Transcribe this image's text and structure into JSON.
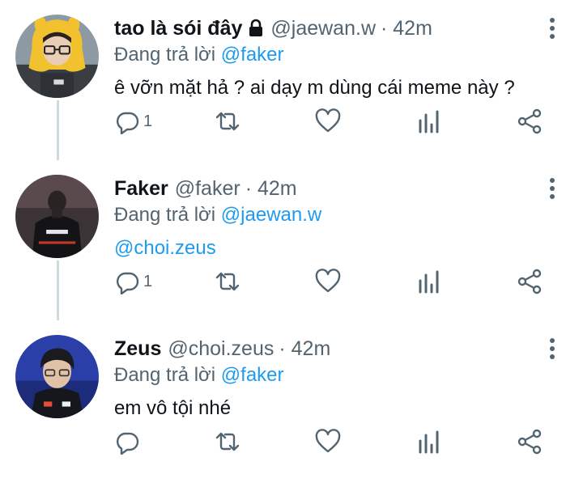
{
  "colors": {
    "accent": "#1d9bf0",
    "secondary": "#536471",
    "thread_line": "#cfd9de"
  },
  "icons": {
    "reply": "reply-icon",
    "retweet": "retweet-icon",
    "like": "heart-icon",
    "analytics": "analytics-icon",
    "share": "share-icon",
    "more": "more-icon",
    "lock": "lock-icon"
  },
  "tweets": [
    {
      "name": "tao là sói đây",
      "handle": "@jaewan.w",
      "time": "· 42m",
      "reply_prefix": "Đang trả lời",
      "reply_to": "@faker",
      "text": "ê vỡn mặt hả ? ai dạy m dùng cái meme này ?",
      "reply_count": "1",
      "locked": true
    },
    {
      "name": "Faker",
      "handle": "@faker",
      "time": "· 42m",
      "reply_prefix": "Đang trả lời",
      "reply_to": "@jaewan.w",
      "text": "@choi.zeus",
      "reply_count": "1",
      "locked": false
    },
    {
      "name": "Zeus",
      "handle": "@choi.zeus",
      "time": "· 42m",
      "reply_prefix": "Đang trả lời",
      "reply_to": "@faker",
      "text": "em vô tội nhé",
      "reply_count": "",
      "locked": false
    }
  ]
}
